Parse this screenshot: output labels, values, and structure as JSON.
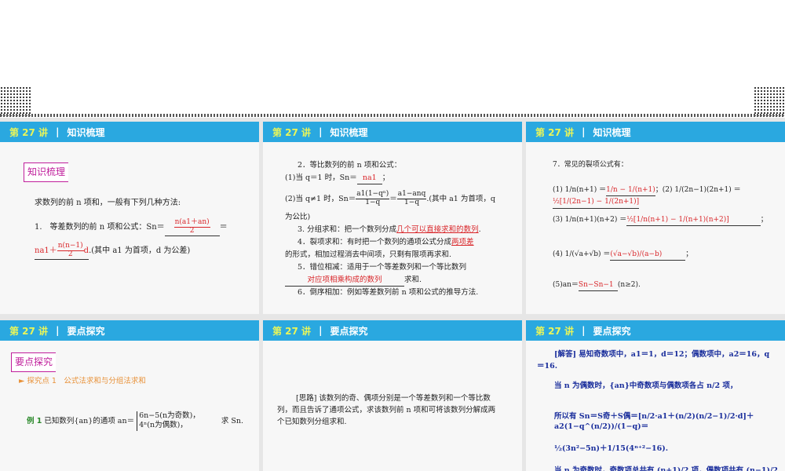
{
  "slides": [
    {
      "lecture": "第 27 讲",
      "section": "知识梳理",
      "tag": "知识梳理",
      "intro": "求数列的前 n 项和，一般有下列几种方法:",
      "item1": "1.　等差数列的前 n 项和公式：Sn＝",
      "ans1_num": "n(a1＋an)",
      "ans1_den": "2",
      "eq": "＝",
      "ans2_a": "na1＋",
      "ans2_num": "n(n−1)",
      "ans2_den": "2",
      "ans2_d": "d",
      "item1_tail": ".(其中 a1 为首项，d 为公差)"
    },
    {
      "lecture": "第 27 讲",
      "section": "知识梳理",
      "l1": "2．等比数列的前 n 项和公式：",
      "l2a": "(1)当 q＝1 时，Sn＝",
      "l2ans": "na1",
      "l2b": "；",
      "l3a": "(2)当 q≠1 时，Sn＝",
      "l3f1n": "a1(1−qⁿ)",
      "l3f1d": "1−q",
      "l3f2n": "a1−anq",
      "l3f2d": "1−q",
      "l3b": ".(其中 a1 为首项，q",
      "l4": "为公比)",
      "l5a": "3. 分组求和：把一个数列分成",
      "l5ans": "几个可以直接求和的数列",
      "l6a": "4．裂项求和：有时把一个数列的通项公式分成",
      "l6ans": "两项差",
      "l7": "的形式，相加过程消去中间项，只剩有限项再求和.",
      "l8": "5．错位相减：适用于一个等差数列和一个等比数列",
      "l9ans": "对应项相乘构成的数列",
      "l9b": "求和.",
      "l10": "6．倒序相加：例如等差数列前 n 项和公式的推导方法."
    },
    {
      "lecture": "第 27 讲",
      "section": "知识梳理",
      "title": "7．常见的裂项公式有：",
      "f1": "(1) 1/n(n+1) ＝",
      "f1ans": "1/n − 1/(n+1)",
      "f2": "；(2) 1/(2n−1)(2n+1) ＝",
      "f2ans": "½[1/(2n−1) − 1/(2n+1)]",
      "f3": "(3) 1/n(n+1)(n+2) ＝",
      "f3ans": "½[1/n(n+1) − 1/(n+1)(n+2)]",
      "f4": "(4) 1/(√a+√b) ＝",
      "f4ans": "(√a−√b)/(a−b)",
      "f5": "(5)an＝",
      "f5ans": "Sn−Sn−1",
      "f5b": "(n≥2)."
    },
    {
      "lecture": "第 27 讲",
      "section": "要点探究",
      "tag": "要点探究",
      "point": "► 探究点 1　公式法求和与分组法求和",
      "ex_label": "例 1",
      "ex_text": "已知数列{an}的通项 an＝",
      "case1": "6n−5(n为奇数)，",
      "case2": "4ⁿ(n为偶数)，",
      "ex_tail": "求 Sn."
    },
    {
      "lecture": "第 27 讲",
      "section": "要点探究",
      "text": "[思路] 该数列的奇、偶项分别是一个等差数列和一个等比数列，而且告诉了通项公式，求该数列前 n 项和可将该数列分解成两个已知数列分组求和."
    },
    {
      "lecture": "第 27 讲",
      "section": "要点探究",
      "s1": "[解答] 易知奇数项中，a1＝1，d＝12；偶数项中，a2＝16，q＝16.",
      "s2": "当 n 为偶数时，{an}中奇数项与偶数项各占 n/2 项，",
      "s3": "所以有 Sn＝S奇＋S偶＝[n/2·a1＋(n/2)(n/2−1)/2·d]＋a2(1−q^(n/2))/(1−q)＝",
      "s4": "½(3n²−5n)＋1/15(4ⁿ⁺²−16).",
      "s5": "当 n 为奇数时，奇数项总共有 (n+1)/2 项，偶数项共有 (n−1)/2"
    }
  ]
}
